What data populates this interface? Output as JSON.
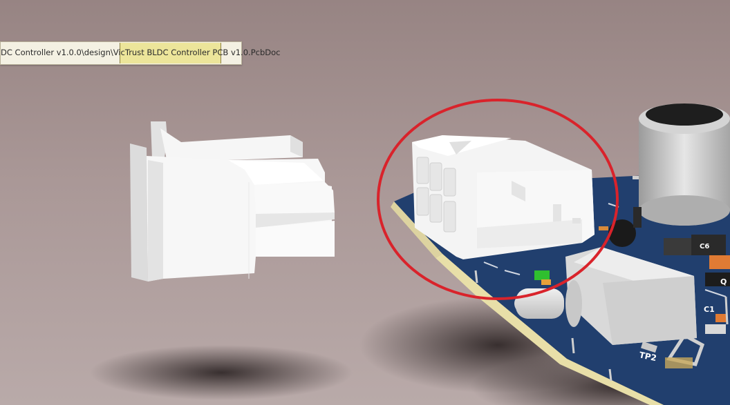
{
  "document_tab": {
    "path": "DC Controller v1.0.0\\design\\VicTrust BLDC Controller PCB v1.0.PcbDoc"
  },
  "pcb_labels": {
    "tp": "TP2",
    "c_ref": "C1",
    "q_ref": "Q",
    "c_ref2": "C6"
  },
  "colors": {
    "background": "#a18e8e",
    "board": "#213f6e",
    "connector": "#f3f3f3",
    "highlight_ellipse": "#d9232b"
  },
  "icons": {
    "annotation": "highlight-ellipse"
  }
}
